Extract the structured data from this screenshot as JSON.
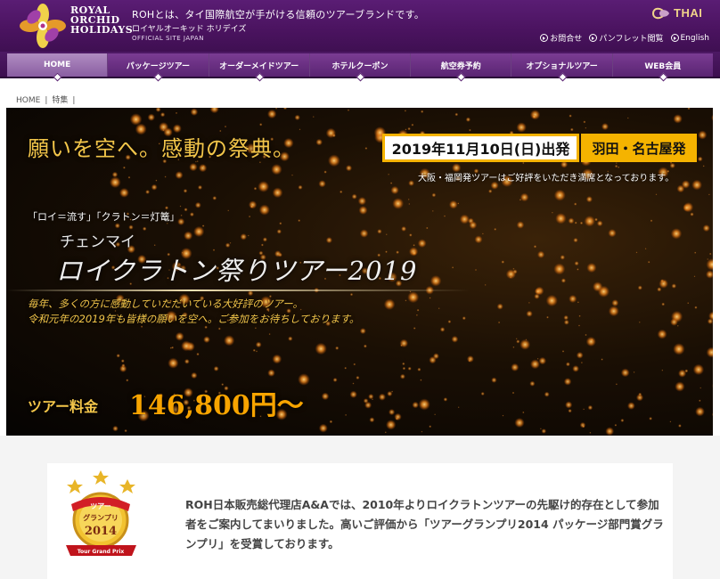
{
  "header": {
    "logo_lines": [
      "ROYAL",
      "ORCHID",
      "HOLIDAYS"
    ],
    "tagline": "ROHとは、タイ国際航空が手がける信頼のツアーブランドです。",
    "site_name": "ロイヤルオーキッド ホリデイズ",
    "site_en": "OFFICIAL SITE JAPAN",
    "partner": "THAI",
    "links": [
      "お問合せ",
      "パンフレット閲覧",
      "English"
    ]
  },
  "nav": {
    "items": [
      "HOME",
      "パッケージツアー",
      "オーダーメイドツアー",
      "ホテルクーポン",
      "航空券予約",
      "オプショナルツアー",
      "WEB会員"
    ]
  },
  "breadcrumb": [
    "HOME",
    "特集"
  ],
  "hero": {
    "headline": "願いを空へ。感動の祭典。",
    "date": "2019年11月10日(日)出発",
    "departure": "羽田・名古屋発",
    "note": "大阪・福岡発ツアーはご好評をいただき満席となっております。",
    "subtitle": "「ロイ＝流す」「クラトン＝灯篭」",
    "city": "チェンマイ",
    "event": "ロイクラトン祭りツアー2019",
    "description_lines": [
      "毎年、多くの方に感動していただいている大好評のツアー。",
      "令和元年の2019年も皆様の願いを空へ。ご参加をお待ちしております。"
    ],
    "price_label": "ツアー料金",
    "price": "146,800円～"
  },
  "award": {
    "badge_lines": [
      "ツアー",
      "グランプリ",
      "2014",
      "Tour Grand Prix"
    ],
    "text": "ROH日本販売総代理店A&Aでは、2010年よりロイクラトンツアーの先駆け的存在として参加者をご案内してまいりました。高いご評価から「ツアーグランプリ2014 パッケージ部門賞グランプリ」を受賞しております。"
  },
  "colors": {
    "header_purple": "#4a135f",
    "accent_gold": "#f3c64a",
    "date_border": "#f5b300",
    "price_orange": "#f7a400"
  }
}
